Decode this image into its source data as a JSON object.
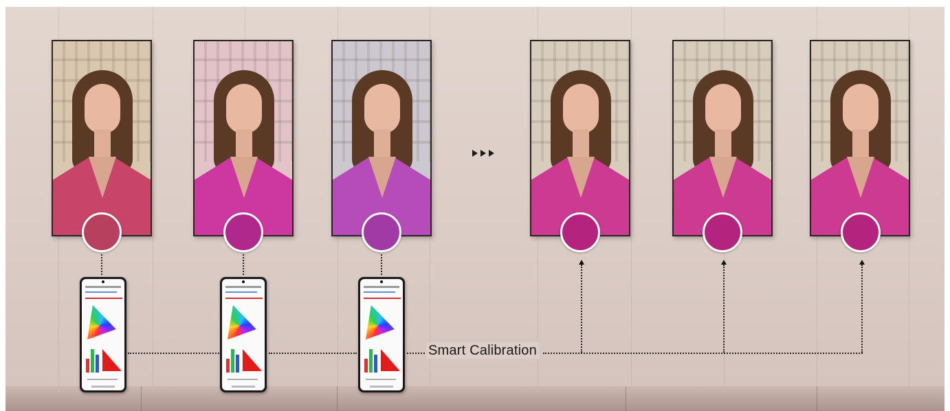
{
  "label": {
    "smart_calibration": "Smart Calibration"
  },
  "displays_before": [
    {
      "tint": "#d9c7b0",
      "jacket": "#c84468",
      "swatch": "#b8405f"
    },
    {
      "tint": "#e2c4c8",
      "jacket": "#cd38a0",
      "swatch": "#b0288c"
    },
    {
      "tint": "#ccc8cf",
      "jacket": "#b64cba",
      "swatch": "#a23aa6"
    }
  ],
  "displays_after": [
    {
      "tint": "#d8cdbd",
      "jacket": "#cc3a92",
      "swatch": "#b4237d"
    },
    {
      "tint": "#d8cdbd",
      "jacket": "#cc3a92",
      "swatch": "#b4237d"
    },
    {
      "tint": "#d8cdbd",
      "jacket": "#cc3a92",
      "swatch": "#b4237d"
    }
  ],
  "icons": {
    "progress_arrows": "triple-chevron-right-icon",
    "calibration_arrow": "arrow-up-icon"
  },
  "colors": {
    "wall": "#ddd0c9",
    "floor": "#b7a39b",
    "line": "#222222"
  }
}
